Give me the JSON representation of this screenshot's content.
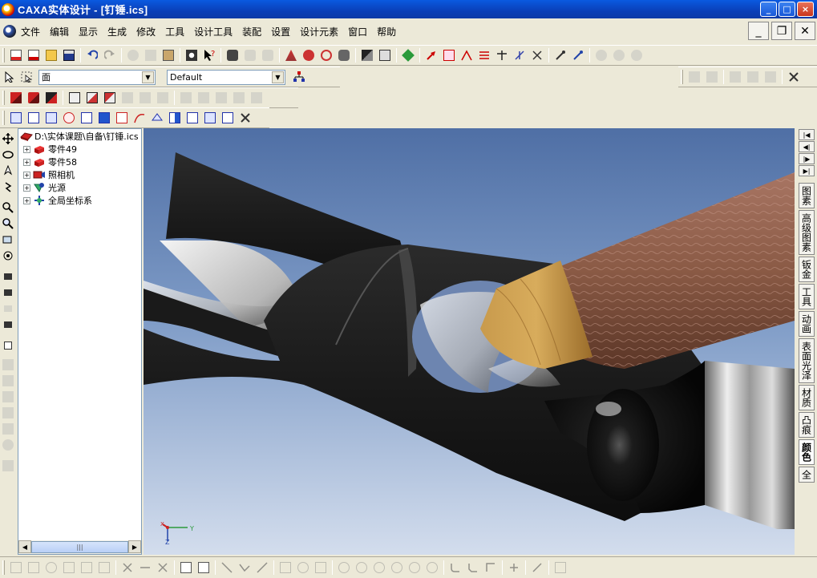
{
  "window": {
    "title": "CAXA实体设计 - [钉锤.ics]",
    "minimize": "_",
    "maximize": "□",
    "close": "×"
  },
  "menu": [
    "文件",
    "编辑",
    "显示",
    "生成",
    "修改",
    "工具",
    "设计工具",
    "装配",
    "设置",
    "设计元素",
    "窗口",
    "帮助"
  ],
  "mdi": {
    "minimize": "_",
    "restore": "❐",
    "close": "✕"
  },
  "selector": {
    "filter_value": "面",
    "config_value": "Default"
  },
  "tree": {
    "root_label": "D:\\实体课题\\自备\\钉锤.ics",
    "items": [
      {
        "label": "零件49",
        "icon": "part-icon"
      },
      {
        "label": "零件58",
        "icon": "part-icon"
      },
      {
        "label": "照相机",
        "icon": "camera-icon"
      },
      {
        "label": "光源",
        "icon": "light-icon"
      },
      {
        "label": "全局坐标系",
        "icon": "coordinate-system-icon"
      }
    ]
  },
  "right_tabs": [
    "图素",
    "高级图素",
    "钣金",
    "工具",
    "动画",
    "表面光泽",
    "材质",
    "凸痕",
    "颜色",
    "全"
  ],
  "active_right_tab": "颜色",
  "axis_triad": {
    "x": "X",
    "y": "Y",
    "z": "Z"
  },
  "colors": {
    "title_bar": "#0a3fb8",
    "chrome": "#ece9d8",
    "viewport_top": "#4f6fa5",
    "viewport_bottom": "#d3dded",
    "hammer_body": "#1a1a1a",
    "handle_wood": "#8a5a45",
    "handle_band": "#b8843c"
  }
}
